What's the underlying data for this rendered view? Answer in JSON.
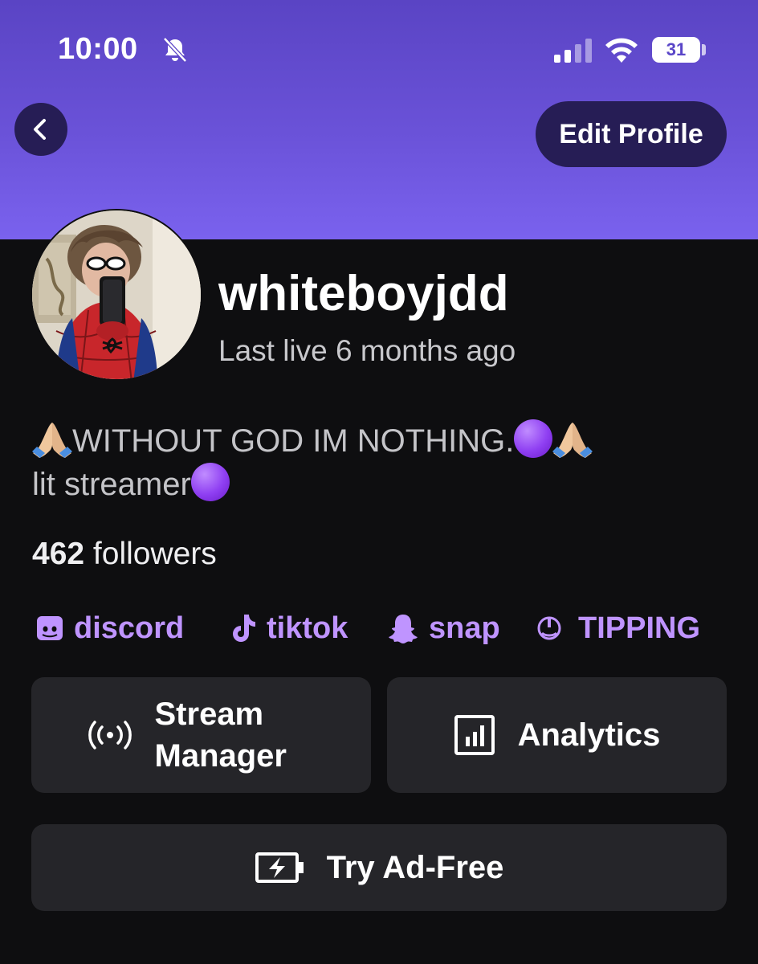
{
  "status_bar": {
    "time": "10:00",
    "battery": "31",
    "icons": [
      "bell-muted-icon",
      "cellular-signal-icon",
      "wifi-icon",
      "battery-icon"
    ]
  },
  "header": {
    "back_icon": "chevron-left-icon",
    "edit_profile_label": "Edit Profile",
    "gradient_colors": [
      "#5a44c4",
      "#7a62ee"
    ]
  },
  "profile": {
    "username": "whiteboyjdd",
    "last_live": "Last live 6 months ago",
    "bio_line1": "WITHOUT GOD IM NOTHING.",
    "bio_line2": "lit streamer",
    "followers_count": "462",
    "followers_label": "followers"
  },
  "links": [
    {
      "label": "discord",
      "icon": "discord-icon"
    },
    {
      "label": "tiktok",
      "icon": "tiktok-icon"
    },
    {
      "label": "snap",
      "icon": "snapchat-icon"
    },
    {
      "label": "TIPPING",
      "icon": "tipping-icon"
    }
  ],
  "actions": {
    "stream_manager_line1": "Stream",
    "stream_manager_line2": "Manager",
    "analytics": "Analytics",
    "try_ad_free": "Try Ad-Free"
  },
  "colors": {
    "accent": "#bf94ff",
    "background": "#0e0e10",
    "card": "#252529",
    "button_dark": "#261d55"
  }
}
